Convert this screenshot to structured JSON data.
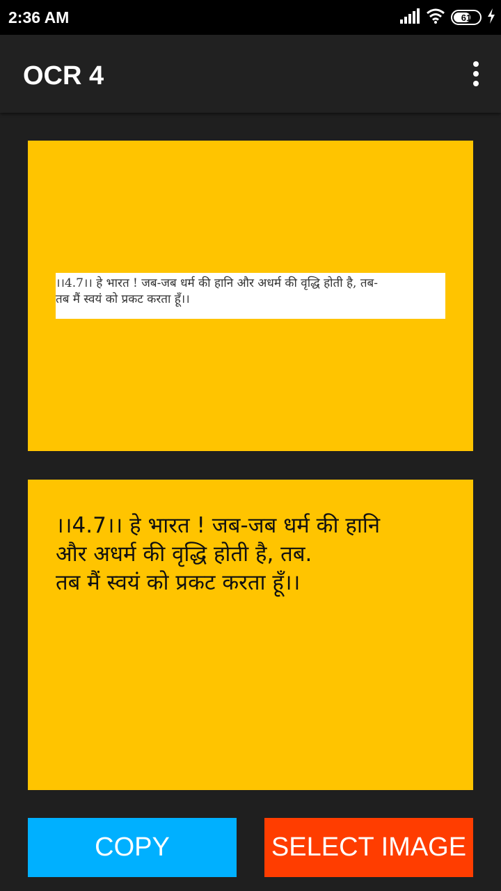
{
  "status_bar": {
    "time": "2:36 AM",
    "battery_level": "61",
    "icons": [
      "signal-icon",
      "wifi-icon",
      "battery-icon",
      "charging-icon"
    ]
  },
  "app_bar": {
    "title": "OCR 4",
    "menu_icon": "more-vert-icon"
  },
  "source_image": {
    "line1": "।।4.7।। हे भारत ! जब-जब धर्म की हानि और अधर्म की वृद्धि होती है,  तब-",
    "line2": "तब मैं स्वयं को प्रकट करता हूँ।।"
  },
  "ocr_result": {
    "lines": [
      "।।4.7।। हे भारत ! जब-जब धर्म की हानि",
      "और अधर्म की वृद्धि होती है, तब.",
      "तब मैं स्वयं को प्रकट करता हूँ।।"
    ]
  },
  "buttons": {
    "copy_label": "COPY",
    "select_image_label": "SELECT IMAGE"
  },
  "colors": {
    "card_bg": "#ffc400",
    "copy_bg": "#00b0ff",
    "select_bg": "#ff3d00",
    "app_bar_bg": "#212121",
    "screen_bg": "#1f1f1f"
  }
}
